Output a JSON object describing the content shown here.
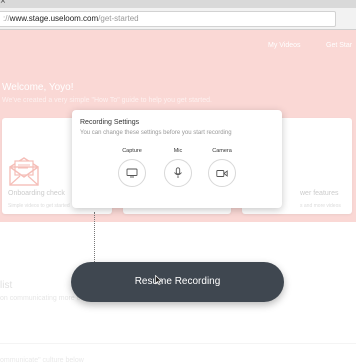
{
  "browser": {
    "tab_close_glyph": "×",
    "url": {
      "prefix": "://",
      "host": "www.stage.useloom.com",
      "path": "/get-started"
    }
  },
  "header": {
    "nav": [
      "My Videos",
      "Get Star"
    ],
    "welcome_title": "Welcome, Yoyo!",
    "welcome_subtitle": "We've created a very simple \"How To\" guide to help you get started."
  },
  "steps": [
    {
      "title": "Onboarding check",
      "subtitle": "Simple videos to get started"
    },
    {
      "title": "",
      "subtitle": ""
    },
    {
      "title": "wer features",
      "subtitle": "s and more videos"
    }
  ],
  "lower": {
    "section_title": "list",
    "section_subtitle": "on communicating more effectively with Loom",
    "bottom_text": "ommunicate\" culture below"
  },
  "recording_settings": {
    "title": "Recording Settings",
    "subtitle": "You can change these settings before you start recording",
    "options": [
      {
        "label": "Capture",
        "icon": "screen-icon"
      },
      {
        "label": "Mic",
        "icon": "microphone-icon"
      },
      {
        "label": "Camera",
        "icon": "video-camera-icon"
      }
    ]
  },
  "resume_button": {
    "label": "Resume Recording"
  },
  "colors": {
    "header_bg": "#f8c9c5",
    "envelope": "#f2a59d",
    "button_bg": "#3f4750"
  }
}
